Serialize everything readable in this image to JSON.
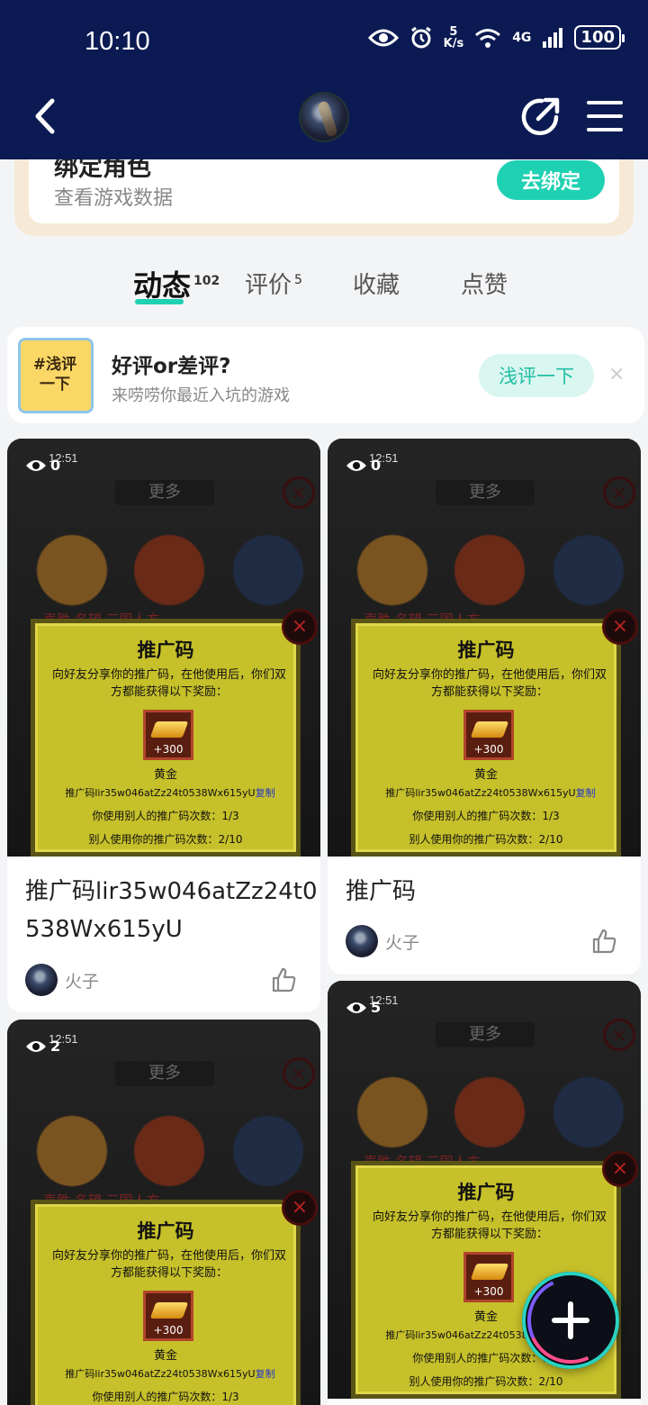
{
  "status_bar": {
    "time": "10:10",
    "net_speed_value": "5",
    "net_speed_unit": "K/s",
    "network": "4G",
    "battery": "100"
  },
  "header": {
    "back_label": "back",
    "share_label": "share",
    "menu_label": "menu"
  },
  "bind": {
    "title": "绑定角色",
    "subtitle": "查看游戏数据",
    "button": "去绑定"
  },
  "tabs": [
    {
      "label": "动态",
      "count": "102",
      "active": true
    },
    {
      "label": "评价",
      "count": "5"
    },
    {
      "label": "收藏"
    },
    {
      "label": "点赞"
    }
  ],
  "review_prompt": {
    "icon_text": "#浅评一下",
    "title": "好评or差评?",
    "subtitle": "来唠唠你最近入坑的游戏",
    "button": "浅评一下",
    "close": "×"
  },
  "screenshot_text": {
    "mini_time": "12:51",
    "more": "更多",
    "tab_row": "声胜 名望 三国人方",
    "panel_title": "推广码",
    "panel_desc": "向好友分享你的推广码，在他使用后，你们双方都能获得以下奖励：",
    "gold_amount": "+300",
    "gold_name": "黄金",
    "code_line": "推广码lir35w046atZz24t0538Wx615yU",
    "copy": "复制",
    "use_self": "你使用别人的推广码次数：1/3",
    "use_others": "别人使用你的推广码次数：2/10"
  },
  "posts": [
    {
      "views": "0",
      "title": "推广码lir35w046atZz24t0538Wx615yU",
      "author": "火子"
    },
    {
      "views": "0",
      "title": "推广码",
      "author": "火子"
    },
    {
      "views": "2"
    },
    {
      "views": "5"
    }
  ],
  "fab": {
    "label": "+"
  }
}
